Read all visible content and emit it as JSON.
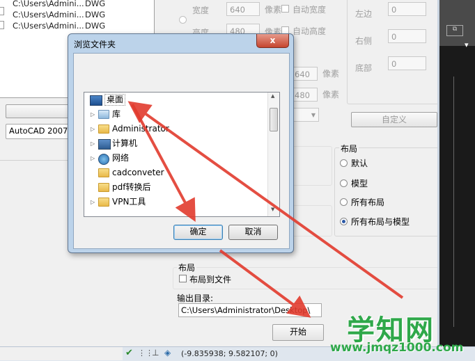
{
  "files": [
    {
      "path": "C:\\Users\\Admini...",
      "type": "DWG"
    },
    {
      "path": "C:\\Users\\Admini...",
      "type": "DWG"
    },
    {
      "path": "C:\\Users\\Admini...",
      "type": "DWG"
    }
  ],
  "left_panel": {
    "version_select": "AutoCAD 2007 D"
  },
  "size": {
    "width_label": "宽度",
    "width_value": "640",
    "height_label": "高度",
    "height_value": "480",
    "unit": "像素",
    "auto_width": "自动宽度",
    "auto_height": "自动高度",
    "size2_w": "640",
    "size2_h": "480"
  },
  "margins": {
    "left_label": "左边",
    "left_value": "0",
    "right_label": "右侧",
    "right_value": "0",
    "bottom_label": "底部",
    "bottom_value": "0",
    "custom_button": "自定义"
  },
  "layout_group": {
    "title": "布局",
    "options": [
      {
        "label": "默认",
        "selected": false
      },
      {
        "label": "模型",
        "selected": false
      },
      {
        "label": "所有布局",
        "selected": false
      },
      {
        "label": "所有布局与模型",
        "selected": true
      }
    ]
  },
  "layout_file": {
    "title": "布局",
    "checkbox": "布局到文件"
  },
  "output": {
    "label": "输出目录:",
    "path": "C:\\Users\\Administrator\\Desktop\\"
  },
  "start_button": "开始",
  "dialog": {
    "title": "浏览文件夹",
    "close": "x",
    "tree": [
      {
        "label": "桌面",
        "icon": "desktop-icon",
        "arrow": ""
      },
      {
        "label": "库",
        "icon": "library-icon",
        "arrow": "▷"
      },
      {
        "label": "Administrator",
        "icon": "user-icon",
        "arrow": "▷"
      },
      {
        "label": "计算机",
        "icon": "computer-icon",
        "arrow": "▷"
      },
      {
        "label": "网络",
        "icon": "network-icon",
        "arrow": "▷"
      },
      {
        "label": "cadconveter",
        "icon": "folder-icon",
        "arrow": ""
      },
      {
        "label": "pdf转换后",
        "icon": "folder-icon",
        "arrow": ""
      },
      {
        "label": "VPN工具",
        "icon": "folder-icon",
        "arrow": "▷"
      }
    ],
    "ok": "确定",
    "cancel": "取消"
  },
  "status": {
    "coords": "(-9.835938; 9.582107; 0)"
  },
  "watermark": {
    "logo": "学知网",
    "url": "www.jmqz1000.com"
  },
  "colors": {
    "arrow": "#e23b2e",
    "dialog_frame": "#bcd3ea",
    "watermark": "#2fa84a"
  }
}
